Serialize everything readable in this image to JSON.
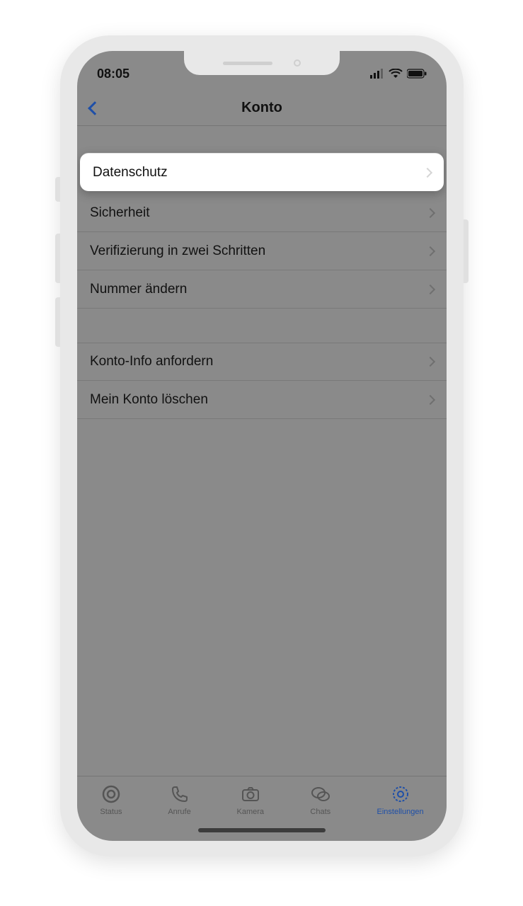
{
  "status": {
    "time": "08:05"
  },
  "header": {
    "title": "Konto"
  },
  "groups": [
    {
      "items": [
        {
          "label": "Datenschutz",
          "highlighted": true,
          "name": "row-datenschutz"
        },
        {
          "label": "Sicherheit",
          "highlighted": false,
          "name": "row-sicherheit"
        },
        {
          "label": "Verifizierung in zwei Schritten",
          "highlighted": false,
          "name": "row-verifizierung"
        },
        {
          "label": "Nummer ändern",
          "highlighted": false,
          "name": "row-nummer-aendern"
        }
      ]
    },
    {
      "items": [
        {
          "label": "Konto-Info anfordern",
          "highlighted": false,
          "name": "row-konto-info"
        },
        {
          "label": "Mein Konto löschen",
          "highlighted": false,
          "name": "row-konto-loeschen"
        }
      ]
    }
  ],
  "tabs": [
    {
      "label": "Status",
      "name": "tab-status",
      "active": false
    },
    {
      "label": "Anrufe",
      "name": "tab-anrufe",
      "active": false
    },
    {
      "label": "Kamera",
      "name": "tab-kamera",
      "active": false
    },
    {
      "label": "Chats",
      "name": "tab-chats",
      "active": false
    },
    {
      "label": "Einstellungen",
      "name": "tab-einstellungen",
      "active": true
    }
  ]
}
